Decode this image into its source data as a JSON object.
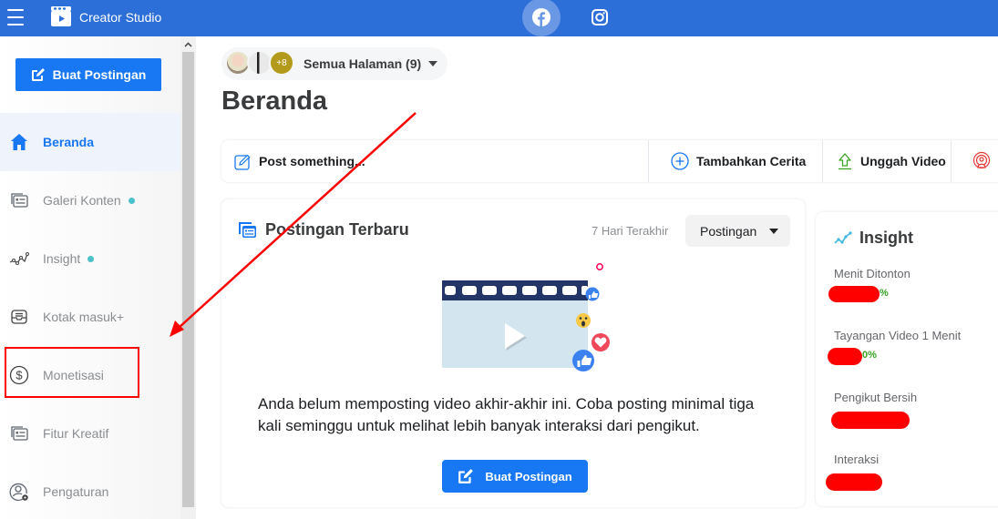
{
  "topbar": {
    "app_title": "Creator Studio",
    "platform_tabs": [
      {
        "name": "facebook",
        "active": true
      },
      {
        "name": "instagram",
        "active": false
      }
    ],
    "color": "#2d6fd8"
  },
  "sidebar": {
    "create_button": "Buat Postingan",
    "items": [
      {
        "label": "Beranda",
        "icon": "home-icon",
        "active": true,
        "dot": false
      },
      {
        "label": "Galeri Konten",
        "icon": "content-library-icon",
        "active": false,
        "dot": true
      },
      {
        "label": "Insight",
        "icon": "insight-chart-icon",
        "active": false,
        "dot": true
      },
      {
        "label": "Kotak masuk+",
        "icon": "inbox-icon",
        "active": false,
        "dot": false
      },
      {
        "label": "Monetisasi",
        "icon": "dollar-icon",
        "active": false,
        "dot": false,
        "highlighted": true
      },
      {
        "label": "Fitur Kreatif",
        "icon": "creative-tools-icon",
        "active": false,
        "dot": false
      },
      {
        "label": "Pengaturan",
        "icon": "settings-user-icon",
        "active": false,
        "dot": false
      }
    ],
    "accent": "#1877f2",
    "dot_color": "#4bc1c9"
  },
  "main": {
    "page_switcher": {
      "extra_count": "+8",
      "label": "Semua Halaman (9)"
    },
    "page_title": "Beranda",
    "actions": {
      "post": "Post something...",
      "story": "Tambahkan Cerita",
      "upload": "Unggah Video"
    },
    "recent_posts": {
      "title": "Postingan Terbaru",
      "range": "7 Hari Terakhir",
      "filter": "Postingan",
      "empty_message": "Anda belum memposting video akhir-akhir ini. Coba posting minimal tiga kali seminggu untuk melihat lebih banyak interaksi dari pengikut.",
      "create_button": "Buat Postingan"
    },
    "insight": {
      "title": "Insight",
      "metrics": [
        {
          "label": "Menit Ditonton",
          "suffix": "%"
        },
        {
          "label": "Tayangan Video 1 Menit",
          "suffix": "0%"
        },
        {
          "label": "Pengikut Bersih",
          "suffix": ""
        },
        {
          "label": "Interaksi",
          "suffix": ""
        }
      ]
    }
  }
}
